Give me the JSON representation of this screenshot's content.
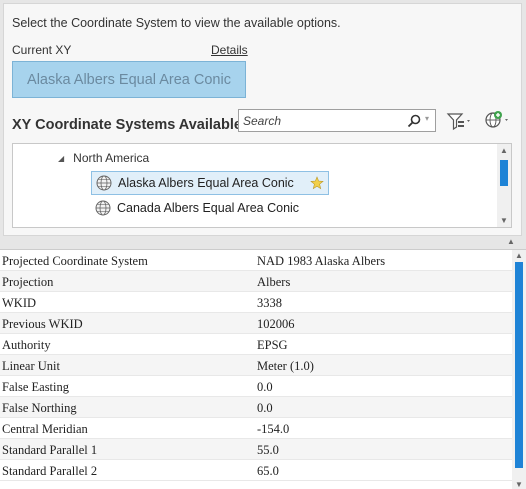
{
  "instructions": "Select the Coordinate System to view the available options.",
  "current": {
    "label": "Current XY",
    "details_link": "Details",
    "value": "Alaska Albers Equal Area Conic"
  },
  "available": {
    "title": "XY Coordinate Systems Available",
    "search_placeholder": "Search"
  },
  "tree": {
    "group": "North America",
    "items": [
      {
        "label": "Alaska Albers Equal Area Conic",
        "selected": true
      },
      {
        "label": "Canada Albers Equal Area Conic",
        "selected": false
      }
    ]
  },
  "properties": [
    {
      "key": "Projected Coordinate System",
      "value": "NAD 1983 Alaska Albers"
    },
    {
      "key": "Projection",
      "value": "Albers"
    },
    {
      "key": "WKID",
      "value": "3338"
    },
    {
      "key": "Previous WKID",
      "value": "102006"
    },
    {
      "key": "Authority",
      "value": "EPSG"
    },
    {
      "key": "Linear Unit",
      "value": "Meter (1.0)"
    },
    {
      "key": "False Easting",
      "value": "0.0"
    },
    {
      "key": "False Northing",
      "value": "0.0"
    },
    {
      "key": "Central Meridian",
      "value": "-154.0"
    },
    {
      "key": "Standard Parallel 1",
      "value": "55.0"
    },
    {
      "key": "Standard Parallel 2",
      "value": "65.0"
    }
  ],
  "colors": {
    "accent": "#1e83d6",
    "current_box_bg": "#a7d3ed",
    "selection_bg": "#e1eff9"
  },
  "icons": [
    "search-icon",
    "filter-icon",
    "add-globe-icon",
    "globe-icon",
    "favorite-pin-icon"
  ]
}
